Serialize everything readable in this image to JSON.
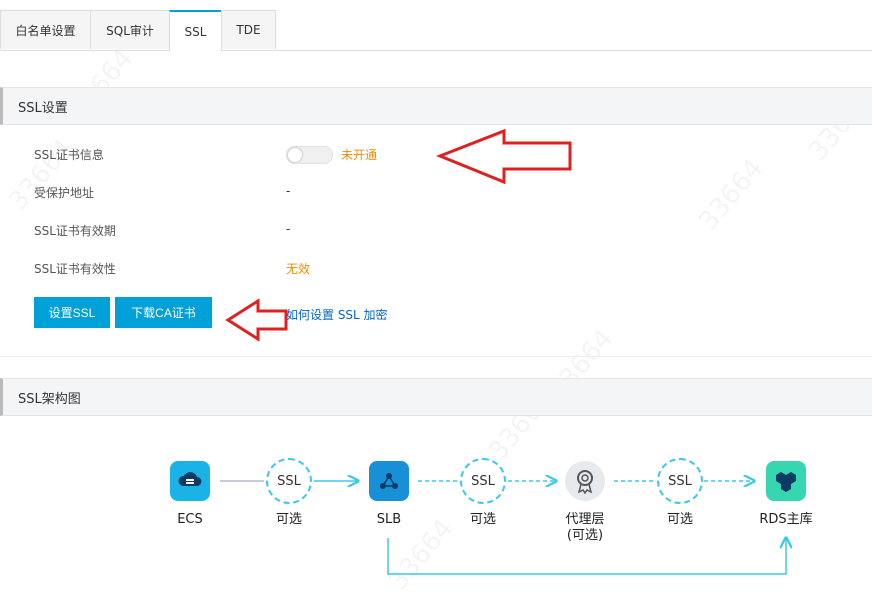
{
  "tabs": [
    {
      "label": "白名单设置"
    },
    {
      "label": "SQL审计"
    },
    {
      "label": "SSL"
    },
    {
      "label": "TDE"
    }
  ],
  "ssl_settings": {
    "title": "SSL设置",
    "cert_info_label": "SSL证书信息",
    "cert_status": "未开通",
    "protected_address_label": "受保护地址",
    "protected_address_value": "-",
    "validity_period_label": "SSL证书有效期",
    "validity_period_value": "-",
    "validity_label": "SSL证书有效性",
    "validity_value": "无效",
    "setup_button": "设置SSL",
    "download_button": "下载CA证书",
    "help_link": "如何设置 SSL 加密"
  },
  "architecture": {
    "title": "SSL架构图",
    "nodes": {
      "ecs": "ECS",
      "slb": "SLB",
      "proxy_line1": "代理层",
      "proxy_line2": "(可选)",
      "rds": "RDS主库"
    },
    "ssl_circle_text": "SSL",
    "optional_label": "可选"
  },
  "colors": {
    "accent": "#00a0d8",
    "warning": "#f08c00",
    "link": "#0066cc",
    "ecs_icon_bg": "#1ab3e8",
    "slb_icon_bg": "#1790d8",
    "proxy_icon_bg": "#e6e9ee",
    "rds_icon_bg": "#35d6b0",
    "connector": "#3cc8ea",
    "annotation_arrow": "#e02020"
  },
  "watermark_text": "33664"
}
